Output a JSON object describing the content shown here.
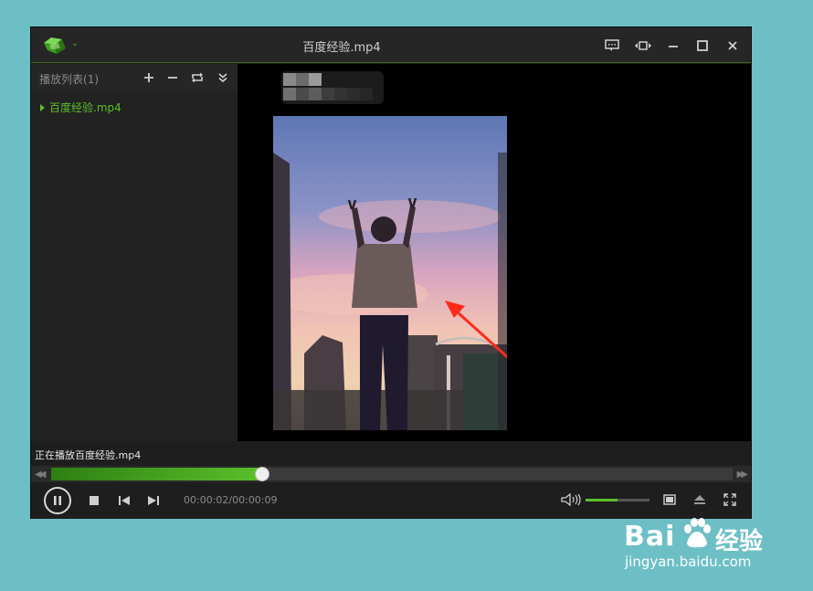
{
  "window": {
    "title": "百度经验.mp4"
  },
  "sidebar": {
    "title": "播放列表",
    "count": "(1)",
    "items": [
      {
        "label": "百度经验.mp4"
      }
    ]
  },
  "status": {
    "now_playing": "正在播放百度经验.mp4"
  },
  "playback": {
    "time": "00:00:02/00:00:09",
    "progress_fraction": 0.31,
    "volume_fraction": 0.5
  },
  "watermark": {
    "brand": "Bai",
    "suffix": "经验",
    "url": "jingyan.baidu.com"
  },
  "colors": {
    "accent": "#5cbf2a",
    "background": "#6dbfc6",
    "annotation_arrow": "#ff2a1a"
  }
}
